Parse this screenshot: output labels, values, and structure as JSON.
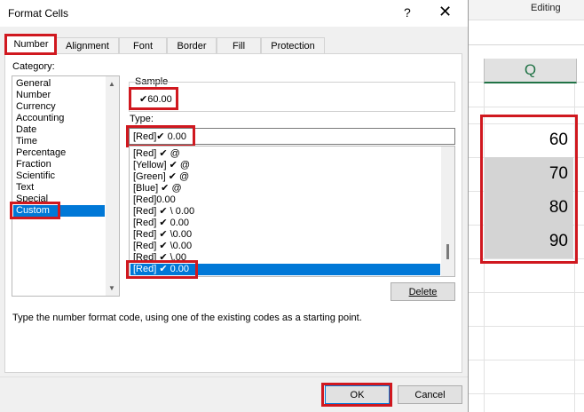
{
  "sheet": {
    "status": "Editing",
    "column_header": "Q",
    "cells": [
      "60",
      "70",
      "80",
      "90"
    ]
  },
  "dialog": {
    "title": "Format Cells",
    "help": "?",
    "close": "✕",
    "tabs": [
      {
        "label": "Number"
      },
      {
        "label": "Alignment"
      },
      {
        "label": "Font"
      },
      {
        "label": "Border"
      },
      {
        "label": "Fill"
      },
      {
        "label": "Protection"
      }
    ],
    "category_label": "Category:",
    "categories": [
      "General",
      "Number",
      "Currency",
      "Accounting",
      "Date",
      "Time",
      "Percentage",
      "Fraction",
      "Scientific",
      "Text",
      "Special",
      "Custom"
    ],
    "selected_category": "Custom",
    "sample_label": "Sample",
    "sample_value": "✔60.00",
    "type_label": "Type:",
    "type_value": "[Red]✔ 0.00",
    "format_codes": [
      "[Red] ✔ @",
      "[Yellow] ✔ @",
      "[Green] ✔ @",
      "[Blue] ✔ @",
      "[Red]0.00",
      "[Red] ✔ \\ 0.00",
      "[Red] ✔ 0.00",
      "[Red] ✔ \\0.00",
      "[Red] ✔ \\0.00",
      "[Red] ✔ \\.00",
      "[Red] ✔ 0.00"
    ],
    "delete_label": "Delete",
    "description": "Type the number format code, using one of the existing codes as a starting point.",
    "ok_label": "OK",
    "cancel_label": "Cancel"
  }
}
